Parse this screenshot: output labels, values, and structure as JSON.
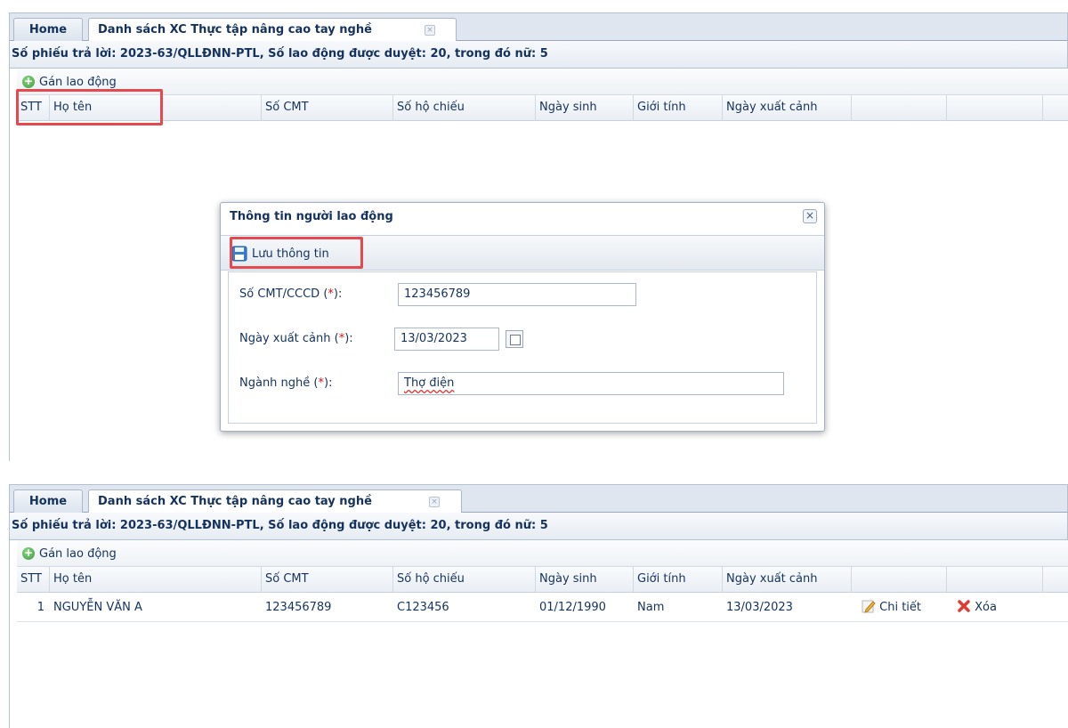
{
  "tabs": {
    "home": "Home",
    "active": "Danh sách XC Thực tập nâng cao tay nghề",
    "close_glyph": "×"
  },
  "header": {
    "text": "Số phiếu trả lời: 2023-63/QLLĐNN-PTL, Số lao động được duyệt: 20, trong đó nữ: 5"
  },
  "toolbar": {
    "assign_label": "Gán lao động"
  },
  "columns": [
    "STT",
    "Họ tên",
    "Số CMT",
    "Số hộ chiếu",
    "Ngày sinh",
    "Giới tính",
    "Ngày xuất cảnh",
    "",
    ""
  ],
  "dialog": {
    "title": "Thông tin người lao động",
    "close_glyph": "×",
    "save_label": "Lưu thông tin",
    "required_mark": "*",
    "fields": {
      "id": {
        "label_pre": "Số CMT/CCCD (",
        "label_post": "):",
        "value": "123456789"
      },
      "date": {
        "label_pre": "Ngày xuất cảnh (",
        "label_post": "):",
        "value": "13/03/2023"
      },
      "job": {
        "label_pre": "Ngành nghề (",
        "label_post": "):",
        "value": "Thợ điện"
      }
    }
  },
  "rows": [
    {
      "stt": "1",
      "name": "NGUYỄN VĂN A",
      "cmt": "123456789",
      "passport": "C123456",
      "dob": "01/12/1990",
      "gender": "Nam",
      "departure": "13/03/2023",
      "detail_label": "Chi tiết",
      "delete_label": "Xóa"
    }
  ],
  "colors": {
    "highlight": "#e5484d",
    "text": "#15325c",
    "required": "#dd1111"
  }
}
